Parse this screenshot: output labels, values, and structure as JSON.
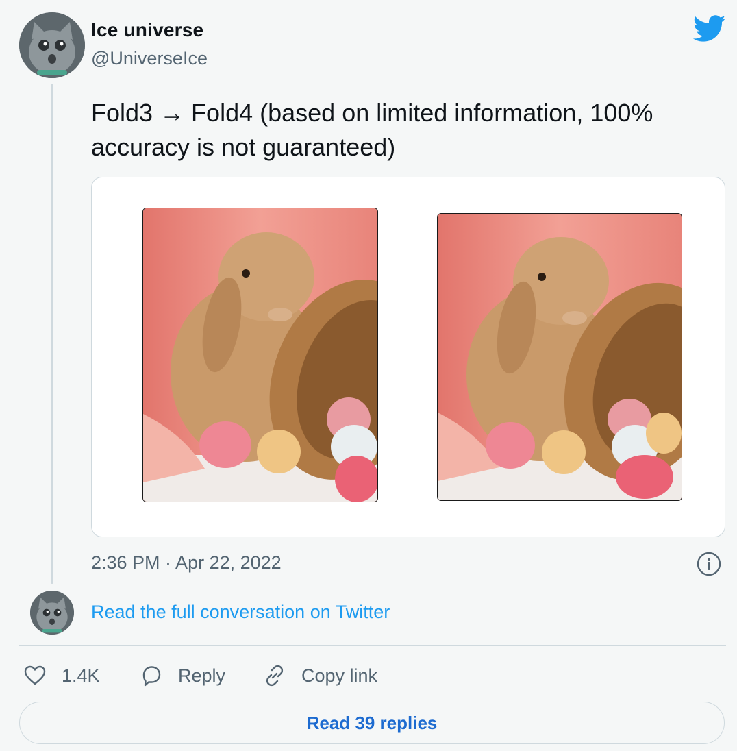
{
  "author": {
    "name": "Ice universe",
    "handle": "@UniverseIce"
  },
  "tweet": {
    "text_line1": "Fold3 → Fold4  (based on limited information, 100%",
    "text_line2": "accuracy is not guaranteed)",
    "timestamp": "2:36 PM · Apr 22, 2022"
  },
  "media": {
    "images": [
      {
        "subject": "rabbit-with-easter-eggs"
      },
      {
        "subject": "rabbit-with-easter-eggs"
      }
    ]
  },
  "conversation": {
    "link_text": "Read the full conversation on Twitter"
  },
  "actions": {
    "like_count": "1.4K",
    "reply_label": "Reply",
    "copy_label": "Copy link"
  },
  "footer": {
    "replies_button": "Read 39 replies"
  },
  "icons": {
    "brand": "twitter-bird-icon",
    "info": "info-icon",
    "like": "heart-icon",
    "reply": "speech-bubble-icon",
    "copy": "link-icon"
  },
  "colors": {
    "accent": "#1d9bf0",
    "link_button": "#1d6bd0",
    "secondary_text": "#536471",
    "border": "#cfd9de"
  }
}
